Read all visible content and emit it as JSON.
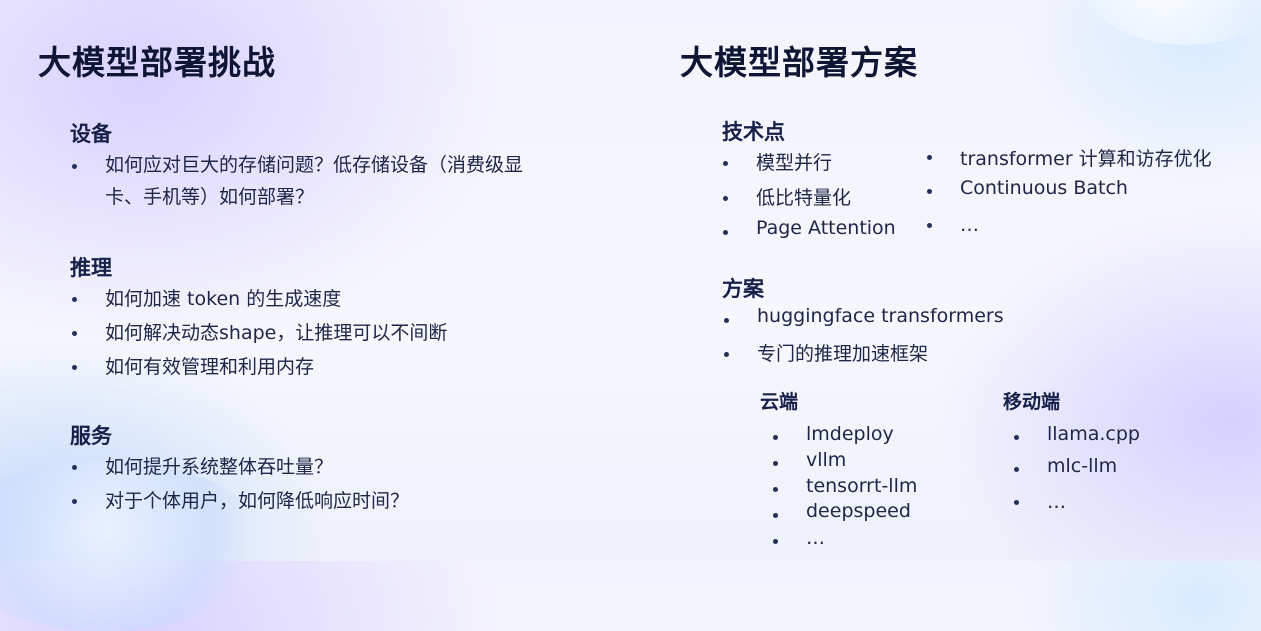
{
  "left": {
    "title": "大模型部署挑战",
    "sections": [
      {
        "heading": "设备",
        "items": [
          "如何应对巨大的存储问题？低存储设备（消费级显卡、手机等）如何部署？"
        ]
      },
      {
        "heading": "推理",
        "items": [
          "如何加速 token 的生成速度",
          "如何解决动态shape，让推理可以不间断",
          "如何有效管理和利用内存"
        ]
      },
      {
        "heading": "服务",
        "items": [
          "如何提升系统整体吞吐量？",
          "对于个体用户，如何降低响应时间？"
        ]
      }
    ]
  },
  "right": {
    "title": "大模型部署方案",
    "tech": {
      "heading": "技术点",
      "col1": [
        "模型并行",
        "低比特量化",
        "Page Attention"
      ],
      "col2": [
        "transformer 计算和访存优化",
        "Continuous Batch",
        "…"
      ]
    },
    "plan": {
      "heading": "方案",
      "items": [
        "huggingface transformers",
        "专门的推理加速框架"
      ]
    },
    "cloud": {
      "heading": "云端",
      "items": [
        "lmdeploy",
        "vllm",
        "tensorrt-llm",
        "deepspeed",
        "…"
      ]
    },
    "mobile": {
      "heading": "移动端",
      "items": [
        "llama.cpp",
        "mlc-llm",
        "…"
      ]
    }
  }
}
